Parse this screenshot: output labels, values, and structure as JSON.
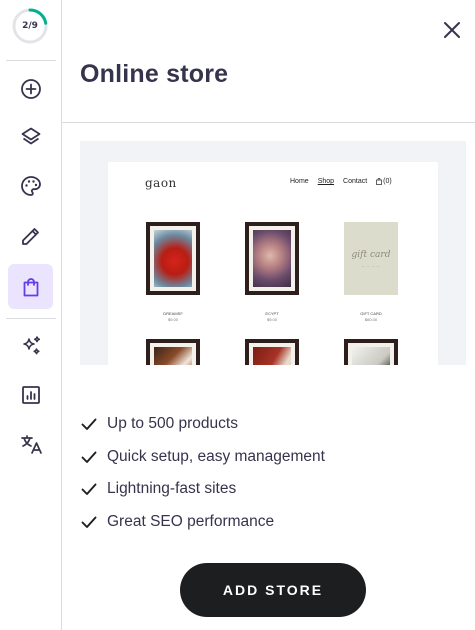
{
  "sidebar": {
    "progress": {
      "text": "2/9",
      "value": 0.222
    },
    "items": [
      {
        "icon": "add-circle-icon",
        "active": false
      },
      {
        "icon": "layers-icon",
        "active": false
      },
      {
        "icon": "palette-icon",
        "active": false
      },
      {
        "icon": "pencil-icon",
        "active": false
      },
      {
        "icon": "shopping-bag-icon",
        "active": true
      },
      {
        "icon": "sparkles-icon",
        "active": false
      },
      {
        "icon": "analytics-icon",
        "active": false
      },
      {
        "icon": "translate-icon",
        "active": false
      }
    ]
  },
  "panel": {
    "title": "Online store",
    "features": [
      "Up to 500 products",
      "Quick setup, easy management",
      "Lightning-fast sites",
      "Great SEO performance"
    ],
    "cta_label": "ADD STORE"
  },
  "preview": {
    "logo": "gaon",
    "nav": {
      "home": "Home",
      "shop": "Shop",
      "contact": "Contact",
      "cart": "(0)"
    },
    "products": [
      {
        "name": "DREAMSF",
        "price": "$9.00"
      },
      {
        "name": "ECYPT",
        "price": "$9.00"
      },
      {
        "name": "GIFT CARD",
        "price": "$60.00"
      }
    ],
    "gift_card_text": "gift card"
  },
  "colors": {
    "accent": "#673de6",
    "active_bg": "#ebe4ff",
    "progress": "#00b090",
    "text": "#36344d",
    "cta_bg": "#1d1e20"
  }
}
